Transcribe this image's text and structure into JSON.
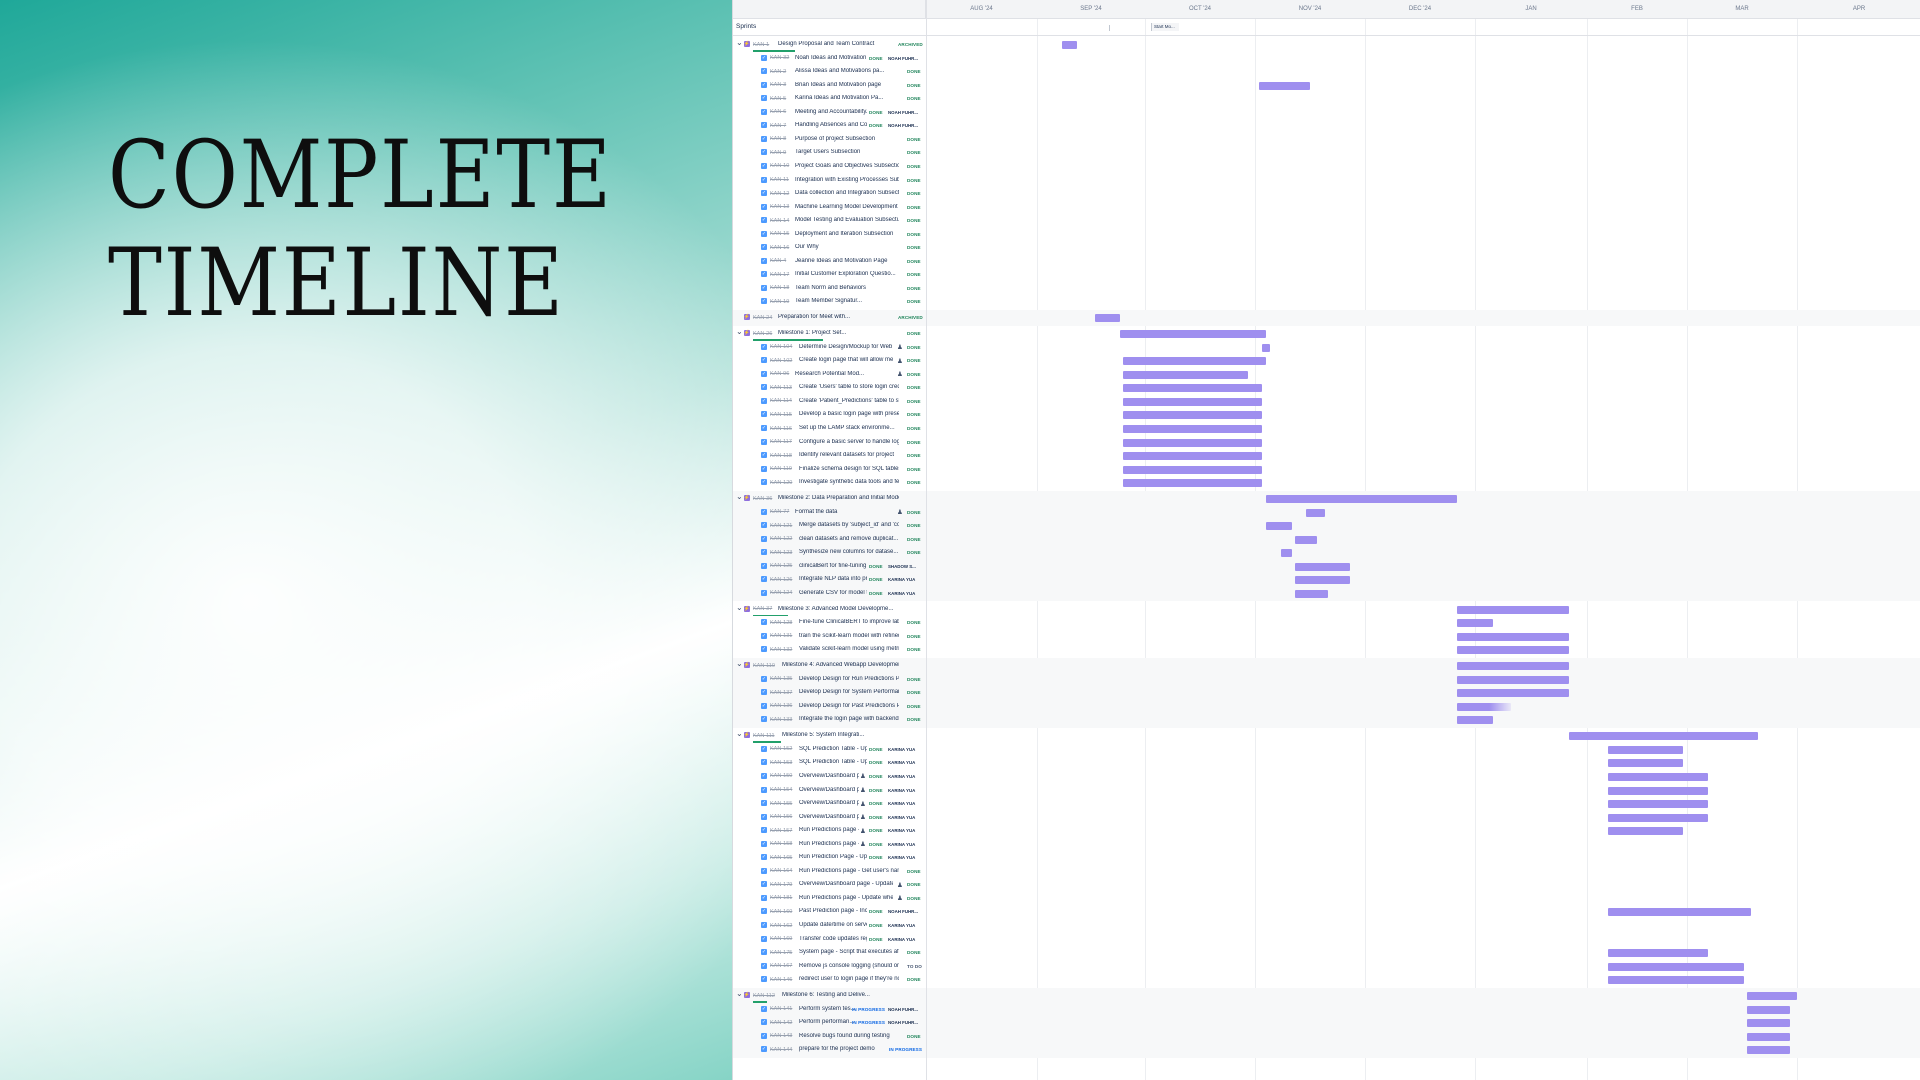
{
  "hero": {
    "title_line1": "COMPLETE",
    "title_line2": "TIMELINE"
  },
  "timeline": {
    "months": [
      "AUG '24",
      "SEP '24",
      "OCT '24",
      "NOV '24",
      "DEC '24",
      "JAN",
      "FEB",
      "MAR",
      "APR"
    ],
    "sprints_label": "Sprints",
    "sprint_chip": "Start Mo...",
    "colors": {
      "bar": "#9f8fef",
      "done": "#1f845a",
      "in_progress": "#0c66e4",
      "epic": "#8f6fde",
      "task": "#4c9aff"
    },
    "rows": [
      {
        "type": "epic",
        "key": "KAN-1",
        "title": "Design Proposal and Team Contract",
        "status": "ARCHIVED",
        "collapsible": true,
        "progress": 0.6,
        "bar": [
          "2024-09-08",
          "2024-09-12"
        ]
      },
      {
        "type": "task",
        "key": "KAN-32",
        "title": "Noah Ideas and Motivation",
        "status": "DONE",
        "assignee": "NOAH FUHR..."
      },
      {
        "type": "task",
        "key": "KAN-2",
        "title": "Alissa Ideas and Motivations pa...",
        "status": "DONE"
      },
      {
        "type": "task",
        "key": "KAN-3",
        "title": "Brian Ideas and Motivation page",
        "status": "DONE",
        "bar": [
          "2024-11-02",
          "2024-11-16"
        ]
      },
      {
        "type": "task",
        "key": "KAN-5",
        "title": "Karina Ideas and Motivation Pa...",
        "status": "DONE"
      },
      {
        "type": "task",
        "key": "KAN-6",
        "title": "Meeting and Accountability...",
        "status": "DONE",
        "assignee": "NOAH FUHR..."
      },
      {
        "type": "task",
        "key": "KAN-7",
        "title": "Handling Absences and Con...",
        "status": "DONE",
        "assignee": "NOAH FUHR..."
      },
      {
        "type": "task",
        "key": "KAN-8",
        "title": "Purpose of project Subsection",
        "status": "DONE"
      },
      {
        "type": "task",
        "key": "KAN-9",
        "title": "Target Users Subsection",
        "status": "DONE"
      },
      {
        "type": "task",
        "key": "KAN-10",
        "title": "Project Goals and Objectives Subsection",
        "status": "DONE"
      },
      {
        "type": "task",
        "key": "KAN-11",
        "title": "Integration with Existing Processes Subs...",
        "status": "DONE"
      },
      {
        "type": "task",
        "key": "KAN-12",
        "title": "Data collection and Integration Subsecti...",
        "status": "DONE"
      },
      {
        "type": "task",
        "key": "KAN-13",
        "title": "Machine Learning Model Development Su...",
        "status": "DONE"
      },
      {
        "type": "task",
        "key": "KAN-14",
        "title": "Model Testing and Evaluation Subsecti...",
        "status": "DONE"
      },
      {
        "type": "task",
        "key": "KAN-15",
        "title": "Deployment and Iteration Subsection",
        "status": "DONE"
      },
      {
        "type": "task",
        "key": "KAN-16",
        "title": "Our Why",
        "status": "DONE"
      },
      {
        "type": "task",
        "key": "KAN-4",
        "title": "Jeanne Ideas and Motivation Page",
        "status": "DONE"
      },
      {
        "type": "task",
        "key": "KAN-17",
        "title": "Initial Customer Exploration Questio...",
        "status": "DONE"
      },
      {
        "type": "task",
        "key": "KAN-18",
        "title": "Team Norm and Behaviors",
        "status": "DONE"
      },
      {
        "type": "task",
        "key": "KAN-19",
        "title": "Team Member Signatur...",
        "status": "DONE"
      },
      {
        "type": "epic",
        "key": "KAN-24",
        "title": "Preparation for Meet with...",
        "status": "ARCHIVED",
        "collapsible": false,
        "group_gap": true,
        "bar": [
          "2024-09-17",
          "2024-09-24"
        ]
      },
      {
        "type": "epic",
        "key": "KAN-26",
        "title": "Milestone 1: Project Set...",
        "status": "DONE",
        "collapsible": true,
        "group_gap": true,
        "progress": 1.0,
        "bar": [
          "2024-09-24",
          "2024-11-04"
        ]
      },
      {
        "type": "task",
        "key": "KAN-104",
        "title": "Determine Design/Mockup for Web Ap...",
        "status": "DONE",
        "icon": true,
        "bar": [
          "2024-11-03",
          "2024-11-05"
        ]
      },
      {
        "type": "task",
        "key": "KAN-102",
        "title": "Create login page that will allow me to...",
        "status": "DONE",
        "icon": true,
        "bar": [
          "2024-09-25",
          "2024-11-04"
        ]
      },
      {
        "type": "task",
        "key": "KAN-96",
        "title": "Research Potential Mod...",
        "status": "DONE",
        "icon": true,
        "bar": [
          "2024-09-25",
          "2024-10-30"
        ]
      },
      {
        "type": "task",
        "key": "KAN-113",
        "title": "Create 'Users' table to store login creden...",
        "status": "DONE",
        "bar": [
          "2024-09-25",
          "2024-11-03"
        ]
      },
      {
        "type": "task",
        "key": "KAN-114",
        "title": "Create 'Patient_Predictions' table to stor...",
        "status": "DONE",
        "bar": [
          "2024-09-25",
          "2024-11-03"
        ]
      },
      {
        "type": "task",
        "key": "KAN-115",
        "title": "Develop a basic login page with preset c...",
        "status": "DONE",
        "bar": [
          "2024-09-25",
          "2024-11-03"
        ]
      },
      {
        "type": "task",
        "key": "KAN-116",
        "title": "Set up the LAMP stack environme...",
        "status": "DONE",
        "bar": [
          "2024-09-25",
          "2024-11-03"
        ]
      },
      {
        "type": "task",
        "key": "KAN-117",
        "title": "Configure a basic server to handle login...",
        "status": "DONE",
        "bar": [
          "2024-09-25",
          "2024-11-03"
        ]
      },
      {
        "type": "task",
        "key": "KAN-118",
        "title": "Identify relevant datasets for project",
        "status": "DONE",
        "bar": [
          "2024-09-25",
          "2024-11-03"
        ]
      },
      {
        "type": "task",
        "key": "KAN-119",
        "title": "Finalize schema design for SQL tables a...",
        "status": "DONE",
        "bar": [
          "2024-09-25",
          "2024-11-03"
        ]
      },
      {
        "type": "task",
        "key": "KAN-120",
        "title": "Investigate synthetic data tools and featu...",
        "status": "DONE",
        "bar": [
          "2024-09-25",
          "2024-11-03"
        ]
      },
      {
        "type": "epic",
        "key": "KAN-36",
        "title": "Milestone 2: Data Preparation and Initial Model Deve...",
        "status": "",
        "collapsible": true,
        "group_gap": true,
        "bar": [
          "2024-11-04",
          "2024-12-27"
        ]
      },
      {
        "type": "task",
        "key": "KAN-77",
        "title": "Format the data",
        "status": "DONE",
        "icon": true,
        "bar": [
          "2024-11-15",
          "2024-11-20"
        ]
      },
      {
        "type": "task",
        "key": "KAN-121",
        "title": "Merge datasets by 'subject_id' and 'coun...",
        "status": "DONE",
        "bar": [
          "2024-11-04",
          "2024-11-11"
        ]
      },
      {
        "type": "task",
        "key": "KAN-122",
        "title": "clean datasets and remove duplicat...",
        "status": "DONE",
        "bar": [
          "2024-11-12",
          "2024-11-18"
        ]
      },
      {
        "type": "task",
        "key": "KAN-123",
        "title": "Synthesize new columns for datase...",
        "status": "DONE",
        "bar": [
          "2024-11-08",
          "2024-11-11"
        ]
      },
      {
        "type": "task",
        "key": "KAN-125",
        "title": "clinicalBert for fine-tuning a...",
        "status": "DONE",
        "assignee": "SHADOW S...",
        "bar": [
          "2024-11-12",
          "2024-11-27"
        ]
      },
      {
        "type": "task",
        "key": "KAN-126",
        "title": "Integrate NLP data into pr...",
        "status": "DONE",
        "assignee": "KARINA YUA",
        "bar": [
          "2024-11-12",
          "2024-11-27"
        ]
      },
      {
        "type": "task",
        "key": "KAN-124",
        "title": "Generate CSV for model tr...",
        "status": "DONE",
        "assignee": "KARINA YUA",
        "bar": [
          "2024-11-12",
          "2024-11-21"
        ]
      },
      {
        "type": "epic",
        "key": "KAN-37",
        "title": "Milestone 3: Advanced Model Developme...",
        "status": "",
        "collapsible": true,
        "group_gap": true,
        "progress": 0.5,
        "bar": [
          "2024-12-27",
          "2025-01-27"
        ]
      },
      {
        "type": "task",
        "key": "KAN-128",
        "title": "Fine-tune ClinicalBERT to improve labeli...",
        "status": "DONE",
        "bar": [
          "2024-12-27",
          "2025-01-06"
        ]
      },
      {
        "type": "task",
        "key": "KAN-131",
        "title": "train the scikit-learn model with refined fe...",
        "status": "DONE",
        "bar": [
          "2024-12-27",
          "2025-01-27"
        ]
      },
      {
        "type": "task",
        "key": "KAN-132",
        "title": "Validate scikit-learn model using metrics...",
        "status": "DONE",
        "bar": [
          "2024-12-27",
          "2025-01-27"
        ]
      },
      {
        "type": "epic",
        "key": "KAN-110",
        "title": "Milestone 4: Advanced Webapp Development (Das...",
        "status": "",
        "collapsible": true,
        "group_gap": true,
        "bar": [
          "2024-12-27",
          "2025-01-27"
        ]
      },
      {
        "type": "task",
        "key": "KAN-135",
        "title": "Develop Design for Run Predictions Pa...",
        "status": "DONE",
        "bar": [
          "2024-12-27",
          "2025-01-27"
        ]
      },
      {
        "type": "task",
        "key": "KAN-137",
        "title": "Develop Design for System Performanca...",
        "status": "DONE",
        "bar": [
          "2024-12-27",
          "2025-01-27"
        ]
      },
      {
        "type": "task",
        "key": "KAN-136",
        "title": "Develop Design for Past Predictions Page",
        "status": "DONE",
        "bar": [
          "2024-12-27",
          "2025-01-11"
        ],
        "fade": true
      },
      {
        "type": "task",
        "key": "KAN-133",
        "title": "Integrate the login page with backend",
        "status": "DONE",
        "bar": [
          "2024-12-27",
          "2025-01-06"
        ]
      },
      {
        "type": "epic",
        "key": "KAN-111",
        "title": "Milestone 5: System Integrati...",
        "status": "",
        "collapsible": true,
        "group_gap": true,
        "progress": 0.4,
        "bar": [
          "2025-01-27",
          "2025-03-21"
        ]
      },
      {
        "type": "task",
        "key": "KAN-152",
        "title": "SQL Prediction Table - Up...",
        "status": "DONE",
        "assignee": "KARINA YUA",
        "bar": [
          "2025-02-07",
          "2025-02-28"
        ]
      },
      {
        "type": "task",
        "key": "KAN-153",
        "title": "SQL Prediction Table - Up...",
        "status": "DONE",
        "assignee": "KARINA YUA",
        "bar": [
          "2025-02-07",
          "2025-02-28"
        ]
      },
      {
        "type": "task",
        "key": "KAN-150",
        "title": "Overview/Dashboard pa...",
        "status": "DONE",
        "assignee": "KARINA YUA",
        "icon": true,
        "bar": [
          "2025-02-07",
          "2025-03-07"
        ]
      },
      {
        "type": "task",
        "key": "KAN-154",
        "title": "Overview/Dashboard pa...",
        "status": "DONE",
        "assignee": "KARINA YUA",
        "icon": true,
        "bar": [
          "2025-02-07",
          "2025-03-07"
        ]
      },
      {
        "type": "task",
        "key": "KAN-155",
        "title": "Overview/Dashboard pa...",
        "status": "DONE",
        "assignee": "KARINA YUA",
        "icon": true,
        "bar": [
          "2025-02-07",
          "2025-03-07"
        ]
      },
      {
        "type": "task",
        "key": "KAN-156",
        "title": "Overview/Dashboard pa...",
        "status": "DONE",
        "assignee": "KARINA YUA",
        "icon": true,
        "bar": [
          "2025-02-07",
          "2025-03-07"
        ]
      },
      {
        "type": "task",
        "key": "KAN-157",
        "title": "Run Predictions page -...",
        "status": "DONE",
        "assignee": "KARINA YUA",
        "icon": true,
        "bar": [
          "2025-02-07",
          "2025-02-28"
        ]
      },
      {
        "type": "task",
        "key": "KAN-158",
        "title": "Run Predictions page -...",
        "status": "DONE",
        "assignee": "KARINA YUA",
        "icon": true
      },
      {
        "type": "task",
        "key": "KAN-165",
        "title": "Run Prediction Page - Upd...",
        "status": "DONE",
        "assignee": "KARINA YUA"
      },
      {
        "type": "task",
        "key": "KAN-164",
        "title": "Run Predictions page - Get user's name...",
        "status": "DONE"
      },
      {
        "type": "task",
        "key": "KAN-179",
        "title": "Overview/Dashboard page - Update w...",
        "status": "DONE",
        "icon": true
      },
      {
        "type": "task",
        "key": "KAN-181",
        "title": "Run Predictions page - Update when...",
        "status": "DONE",
        "icon": true
      },
      {
        "type": "task",
        "key": "KAN-160",
        "title": "Past Prediction page - Inc...",
        "status": "DONE",
        "assignee": "NOAH FUHR...",
        "bar": [
          "2025-02-07",
          "2025-03-19"
        ]
      },
      {
        "type": "task",
        "key": "KAN-162",
        "title": "Update date/time on serve...",
        "status": "DONE",
        "assignee": "KARINA YUA"
      },
      {
        "type": "task",
        "key": "KAN-169",
        "title": "Transfer code updates reg...",
        "status": "DONE",
        "assignee": "KARINA YUA"
      },
      {
        "type": "task",
        "key": "KAN-175",
        "title": "System page - Script that executes after...",
        "status": "DONE",
        "bar": [
          "2025-02-07",
          "2025-03-07"
        ]
      },
      {
        "type": "task",
        "key": "KAN-167",
        "title": "Remove js console logging (should only...",
        "status": "TO DO",
        "bar": [
          "2025-02-07",
          "2025-03-17"
        ]
      },
      {
        "type": "task",
        "key": "KAN-146",
        "title": "redirect user to login page if they're not l...",
        "status": "DONE",
        "bar": [
          "2025-02-07",
          "2025-03-17"
        ]
      },
      {
        "type": "epic",
        "key": "KAN-112",
        "title": "Milestone 6: Testing and Delive...",
        "status": "",
        "collapsible": true,
        "group_gap": true,
        "progress": 0.2,
        "bar": [
          "2025-03-18",
          "2025-04-01"
        ]
      },
      {
        "type": "task",
        "key": "KAN-141",
        "title": "Perform system tes...",
        "status": "IN PROGRESS",
        "assignee": "NOAH FUHR...",
        "bar": [
          "2025-03-18",
          "2025-03-30"
        ]
      },
      {
        "type": "task",
        "key": "KAN-142",
        "title": "Perform performan...",
        "status": "IN PROGRESS",
        "assignee": "NOAH FUHR...",
        "bar": [
          "2025-03-18",
          "2025-03-30"
        ]
      },
      {
        "type": "task",
        "key": "KAN-143",
        "title": "Resolve bugs found during testing",
        "status": "DONE",
        "bar": [
          "2025-03-18",
          "2025-03-30"
        ]
      },
      {
        "type": "task",
        "key": "KAN-144",
        "title": "prepare for the project demo",
        "status": "IN PROGRESS",
        "bar": [
          "2025-03-18",
          "2025-03-30"
        ]
      }
    ]
  }
}
